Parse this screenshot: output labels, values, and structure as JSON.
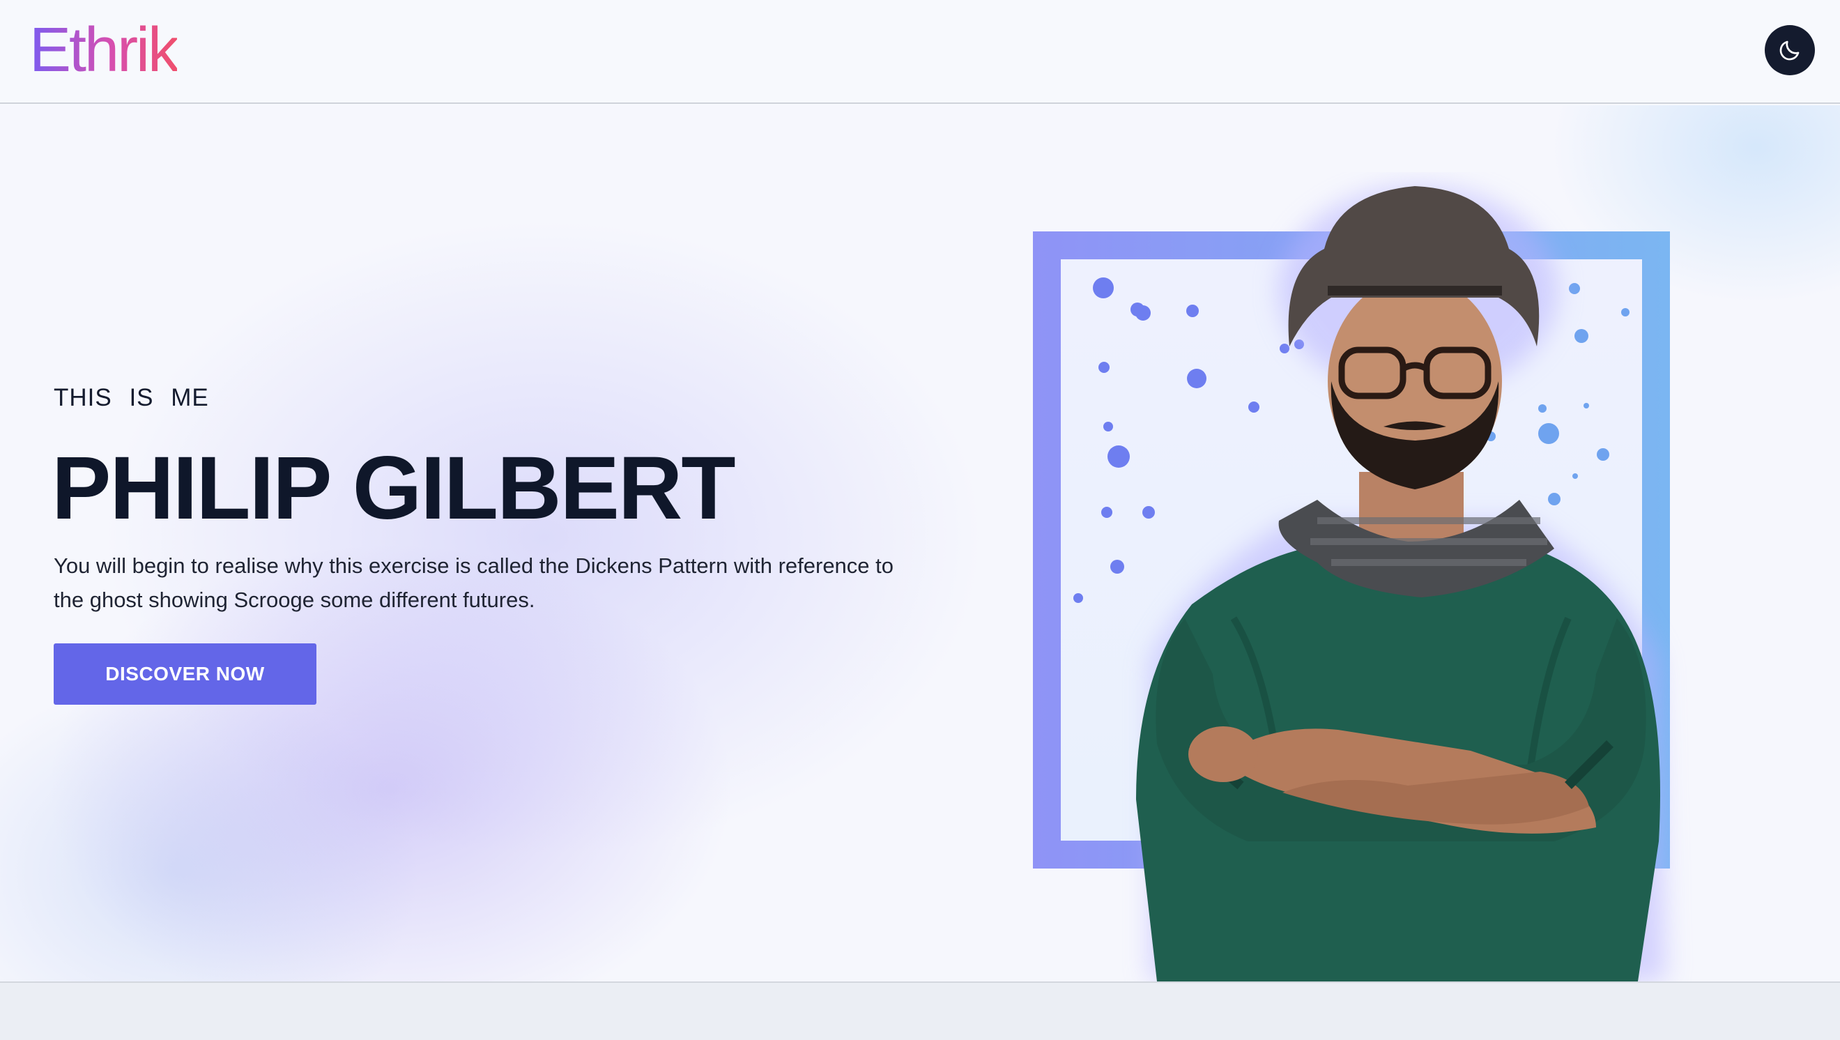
{
  "header": {
    "logo_text": "Ethrik",
    "theme_toggle_icon": "moon-icon"
  },
  "hero": {
    "eyebrow": "THIS IS ME",
    "name": "PHILIP GILBERT",
    "description": "You will begin to realise why this exercise is called the Dickens Pattern with reference to the ghost showing Scrooge some different futures.",
    "cta_label": "DISCOVER NOW",
    "portrait_icon": "portrait-image"
  },
  "colors": {
    "accent": "#6366e8",
    "logo_gradient": [
      "#7c5cf0",
      "#ef4f6d"
    ],
    "frame_gradient": [
      "#8f93f6",
      "#7bb6f2"
    ],
    "dark": "#141b2e"
  }
}
